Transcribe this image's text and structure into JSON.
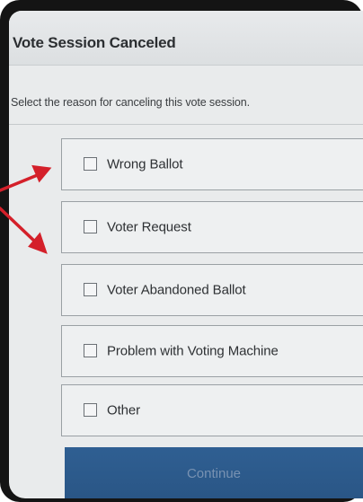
{
  "dialog": {
    "title": "Vote Session Canceled",
    "prompt": "Select the reason for canceling this vote session."
  },
  "options": [
    {
      "label": "Wrong Ballot",
      "checked": false
    },
    {
      "label": "Voter Request",
      "checked": false
    },
    {
      "label": "Voter Abandoned Ballot",
      "checked": false
    },
    {
      "label": "Problem with Voting Machine",
      "checked": false
    },
    {
      "label": "Other",
      "checked": false
    }
  ],
  "continue_button": {
    "label": "Continue",
    "enabled": false
  },
  "annotation": {
    "arrow_color": "#d4202a"
  }
}
